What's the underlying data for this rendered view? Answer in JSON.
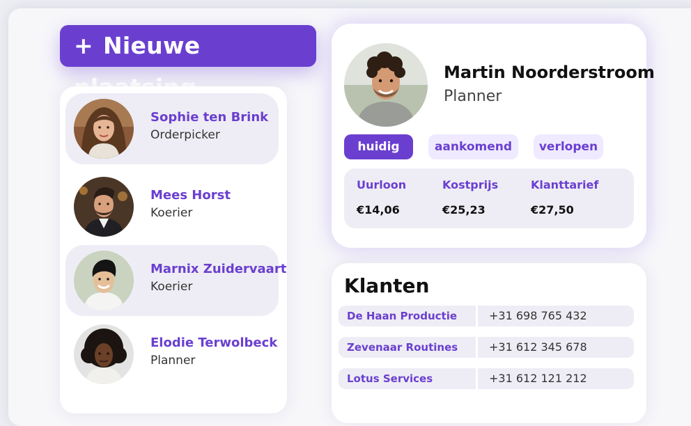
{
  "new_post_button": {
    "plus": "+",
    "label": "Nieuwe plaatsing"
  },
  "people": [
    {
      "name": "Sophie ten Brink",
      "role": "Orderpicker",
      "selected": true,
      "avatar_icon": "woman-long-brown-hair-avatar"
    },
    {
      "name": "Mees Horst",
      "role": "Koerier",
      "selected": false,
      "avatar_icon": "man-beard-quiff-avatar"
    },
    {
      "name": "Marnix Zuidervaart",
      "role": "Koerier",
      "selected": true,
      "avatar_icon": "young-man-smiling-avatar"
    },
    {
      "name": "Elodie Terwolbeck",
      "role": "Planner",
      "selected": false,
      "avatar_icon": "woman-curly-hair-avatar"
    }
  ],
  "profile": {
    "name": "Martin Noorderstroom",
    "role": "Planner",
    "avatar_icon": "man-curly-hair-smiling-avatar",
    "tabs": [
      {
        "label": "huidig",
        "active": true
      },
      {
        "label": "aankomend",
        "active": false
      },
      {
        "label": "verlopen",
        "active": false
      }
    ],
    "stats": [
      {
        "label": "Uurloon",
        "value": "€14,06"
      },
      {
        "label": "Kostprijs",
        "value": "€25,23"
      },
      {
        "label": "Klanttarief",
        "value": "€27,50"
      }
    ]
  },
  "clients": {
    "title": "Klanten",
    "rows": [
      {
        "name": "De Haan Productie",
        "phone": "+31 698 765 432"
      },
      {
        "name": "Zevenaar Routines",
        "phone": "+31 612 345 678"
      },
      {
        "name": "Lotus Services",
        "phone": "+31 612 121 212"
      }
    ]
  },
  "colors": {
    "accent": "#6a3fcf",
    "accent_light": "#efeaff",
    "panel": "#eeedf5"
  }
}
